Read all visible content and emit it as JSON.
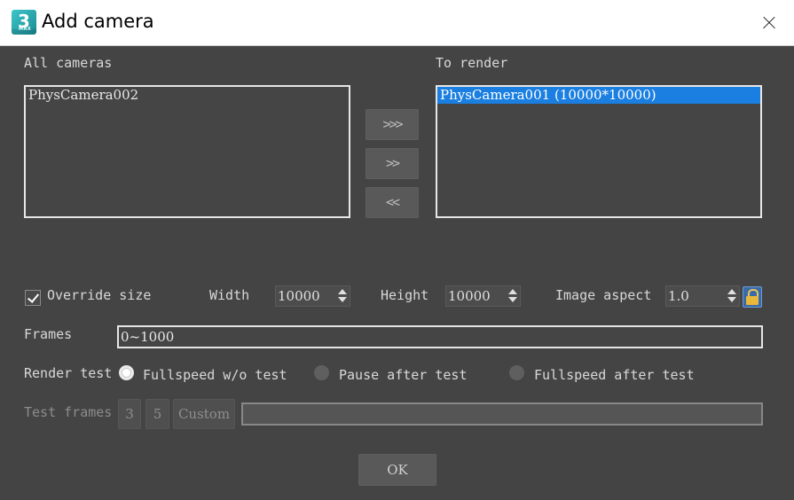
{
  "window": {
    "title": "Add camera",
    "app_icon_text": "3",
    "app_icon_subtext": "MAX"
  },
  "all_cameras": {
    "label": "All cameras",
    "items": [
      "PhysCamera002"
    ]
  },
  "to_render": {
    "label": "To render",
    "items": [
      "PhysCamera001 (10000*10000)"
    ]
  },
  "move_buttons": {
    "add_all": ">>>",
    "add": ">>",
    "remove": "<<"
  },
  "override": {
    "label": "Override size",
    "checked": true
  },
  "width": {
    "label": "Width",
    "value": "10000"
  },
  "height": {
    "label": "Height",
    "value": "10000"
  },
  "image_aspect": {
    "label": "Image aspect",
    "value": "1.0"
  },
  "frames": {
    "label": "Frames",
    "value": "0~1000"
  },
  "render_test": {
    "label": "Render test",
    "options": [
      "Fullspeed w/o test",
      "Pause after test",
      "Fullspeed after test"
    ],
    "selected": "Fullspeed w/o test"
  },
  "test_frames": {
    "label": "Test frames",
    "buttons": [
      "3",
      "5",
      "Custom"
    ],
    "value": ""
  },
  "ok_label": "OK"
}
